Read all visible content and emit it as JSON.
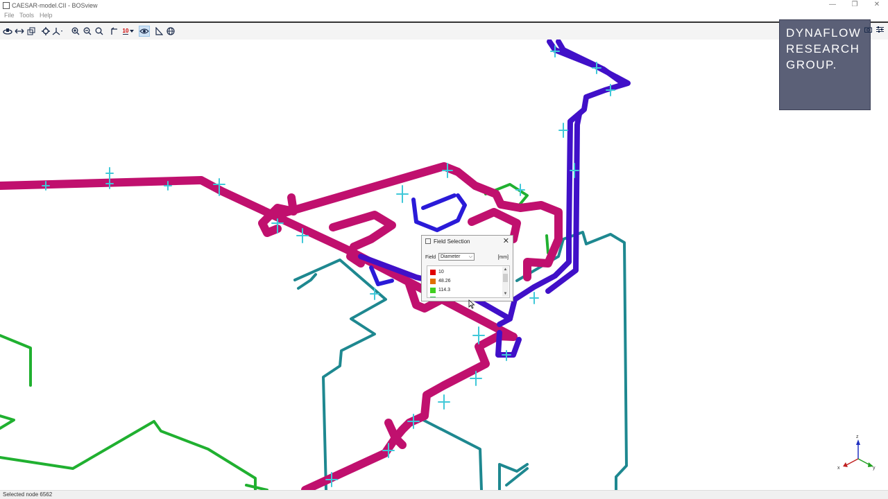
{
  "window": {
    "title": "CAESAR-model.CII - BOSview",
    "minimize_glyph": "—",
    "restore_glyph": "❐",
    "close_glyph": "✕"
  },
  "menu": {
    "items": [
      "File",
      "Tools",
      "Help"
    ]
  },
  "toolbar": {
    "icons": [
      "orbit-icon",
      "pan-icon",
      "view-box-icon",
      "node-target-icon",
      "axes-dropdown-icon",
      "zoom-in-icon",
      "zoom-out-icon",
      "zoom-fit-icon",
      "dimension-icon",
      "label-dropdown-icon",
      "visibility-icon",
      "measure-icon",
      "globe-icon"
    ],
    "label_glyph": "10",
    "active": "visibility-icon"
  },
  "brand": {
    "line1": "DYNAFLOW",
    "line2": "RESEARCH",
    "line3": "GROUP."
  },
  "right_icons": [
    "camera-icon",
    "settings-icon"
  ],
  "field_dialog": {
    "title": "Field Selection",
    "close_glyph": "✕",
    "field_label": "Field",
    "field_value": "Diameter",
    "unit": "[mm]",
    "legend": [
      {
        "value": "10",
        "color": "#e00000"
      },
      {
        "value": "48.26",
        "color": "#e07000"
      },
      {
        "value": "114.3",
        "color": "#40d020"
      }
    ]
  },
  "axis_triad": {
    "z": "z",
    "x": "x",
    "y": "y"
  },
  "status": {
    "text": "Selected node 6562"
  },
  "colors": {
    "pipe_large": "#c0106e",
    "pipe_medium": "#4010c8",
    "pipe_small": "#1e8890",
    "pipe_tiny": "#20b030",
    "support": "#40c8d8"
  }
}
